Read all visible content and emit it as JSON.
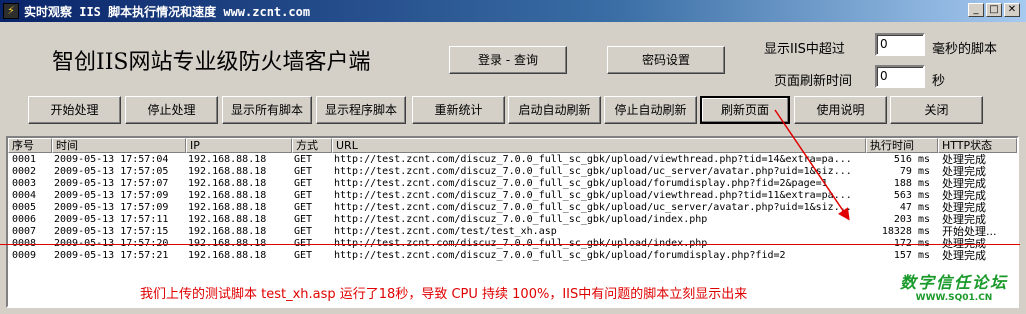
{
  "window": {
    "title": "实时观察 IIS 脚本执行情况和速度 www.zcnt.com",
    "minimize": "_",
    "maximize": "□",
    "close": "✕"
  },
  "header": {
    "brand_title": "智创IIS网站专业级防火墙客户端",
    "login_button": "登录 - 查询",
    "password_button": "密码设置",
    "show_over_label": "显示IIS中超过",
    "show_over_value": "0",
    "show_over_unit": "毫秒的脚本",
    "refresh_label": "页面刷新时间",
    "refresh_value": "0",
    "refresh_unit": "秒"
  },
  "toolbar": [
    {
      "label": "开始处理"
    },
    {
      "label": "停止处理"
    },
    {
      "label": "显示所有脚本"
    },
    {
      "label": "显示程序脚本"
    },
    {
      "label": "重新统计"
    },
    {
      "label": "启动自动刷新"
    },
    {
      "label": "停止自动刷新"
    },
    {
      "label": "刷新页面"
    },
    {
      "label": "使用说明"
    },
    {
      "label": "关闭"
    }
  ],
  "table": {
    "columns": [
      "序号",
      "时间",
      "IP",
      "方式",
      "URL",
      "执行时间",
      "HTTP状态"
    ],
    "rows": [
      [
        "0001",
        "2009-05-13 17:57:04",
        "192.168.88.18",
        "GET",
        "http://test.zcnt.com/discuz_7.0.0_full_sc_gbk/upload/viewthread.php?tid=14&extra=pa...",
        "516 ms",
        "处理完成"
      ],
      [
        "0002",
        "2009-05-13 17:57:05",
        "192.168.88.18",
        "GET",
        "http://test.zcnt.com/discuz_7.0.0_full_sc_gbk/upload/uc_server/avatar.php?uid=1&siz...",
        "79 ms",
        "处理完成"
      ],
      [
        "0003",
        "2009-05-13 17:57:07",
        "192.168.88.18",
        "GET",
        "http://test.zcnt.com/discuz_7.0.0_full_sc_gbk/upload/forumdisplay.php?fid=2&page=1",
        "188 ms",
        "处理完成"
      ],
      [
        "0004",
        "2009-05-13 17:57:09",
        "192.168.88.18",
        "GET",
        "http://test.zcnt.com/discuz_7.0.0_full_sc_gbk/upload/viewthread.php?tid=11&extra=pa...",
        "563 ms",
        "处理完成"
      ],
      [
        "0005",
        "2009-05-13 17:57:09",
        "192.168.88.18",
        "GET",
        "http://test.zcnt.com/discuz_7.0.0_full_sc_gbk/upload/uc_server/avatar.php?uid=1&siz...",
        "47 ms",
        "处理完成"
      ],
      [
        "0006",
        "2009-05-13 17:57:11",
        "192.168.88.18",
        "GET",
        "http://test.zcnt.com/discuz_7.0.0_full_sc_gbk/upload/index.php",
        "203 ms",
        "处理完成"
      ],
      [
        "0007",
        "2009-05-13 17:57:15",
        "192.168.88.18",
        "GET",
        "http://test.zcnt.com/test/test_xh.asp",
        "18328 ms",
        "开始处理..."
      ],
      [
        "0008",
        "2009-05-13 17:57:20",
        "192.168.88.18",
        "GET",
        "http://test.zcnt.com/discuz_7.0.0_full_sc_gbk/upload/index.php",
        "172 ms",
        "处理完成"
      ],
      [
        "0009",
        "2009-05-13 17:57:21",
        "192.168.88.18",
        "GET",
        "http://test.zcnt.com/discuz_7.0.0_full_sc_gbk/upload/forumdisplay.php?fid=2",
        "157 ms",
        "处理完成"
      ]
    ]
  },
  "annotation": "我们上传的测试脚本 test_xh.asp 运行了18秒，导致 CPU 持续 100%，IIS中有问题的脚本立刻显示出来",
  "watermark": {
    "main": "数字信任论坛",
    "sub": "WWW.SQ01.CN"
  },
  "colors": {
    "annotation": "#e00000",
    "watermark": "#1a9a2a",
    "titlebar": "#0a246a"
  }
}
